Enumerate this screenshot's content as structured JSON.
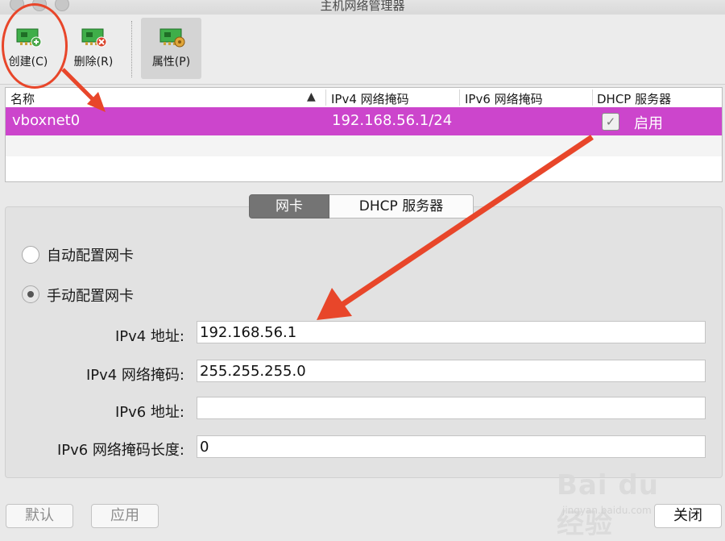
{
  "window": {
    "title": "主机网络管理器"
  },
  "toolbar": {
    "create_label": "创建(C)",
    "remove_label": "删除(R)",
    "properties_label": "属性(P)"
  },
  "table": {
    "headers": [
      "名称",
      "IPv4 网络掩码",
      "IPv6 网络掩码",
      "DHCP 服务器"
    ],
    "sort_indicator": "▲",
    "rows": [
      {
        "name": "vboxnet0",
        "ipv4": "192.168.56.1/24",
        "ipv6": "",
        "dhcp_checked": true,
        "dhcp_label": "启用"
      }
    ]
  },
  "tabs": {
    "adapter": "网卡",
    "dhcp": "DHCP 服务器"
  },
  "adapter": {
    "auto_label": "自动配置网卡",
    "manual_label": "手动配置网卡",
    "selected_mode": "manual",
    "ipv4_address_label": "IPv4 地址:",
    "ipv4_address_value": "192.168.56.1",
    "ipv4_mask_label": "IPv4 网络掩码:",
    "ipv4_mask_value": "255.255.255.0",
    "ipv6_address_label": "IPv6 地址:",
    "ipv6_address_value": "",
    "ipv6_prefix_label": "IPv6 网络掩码长度:",
    "ipv6_prefix_value": "0"
  },
  "buttons": {
    "reset": "默认",
    "apply": "应用",
    "close": "关闭"
  },
  "watermark": {
    "brand": "Bai du 经验",
    "url": "jingyan.baidu.com"
  },
  "colors": {
    "selection": "#cc45cc",
    "annotation": "#e8462a"
  }
}
